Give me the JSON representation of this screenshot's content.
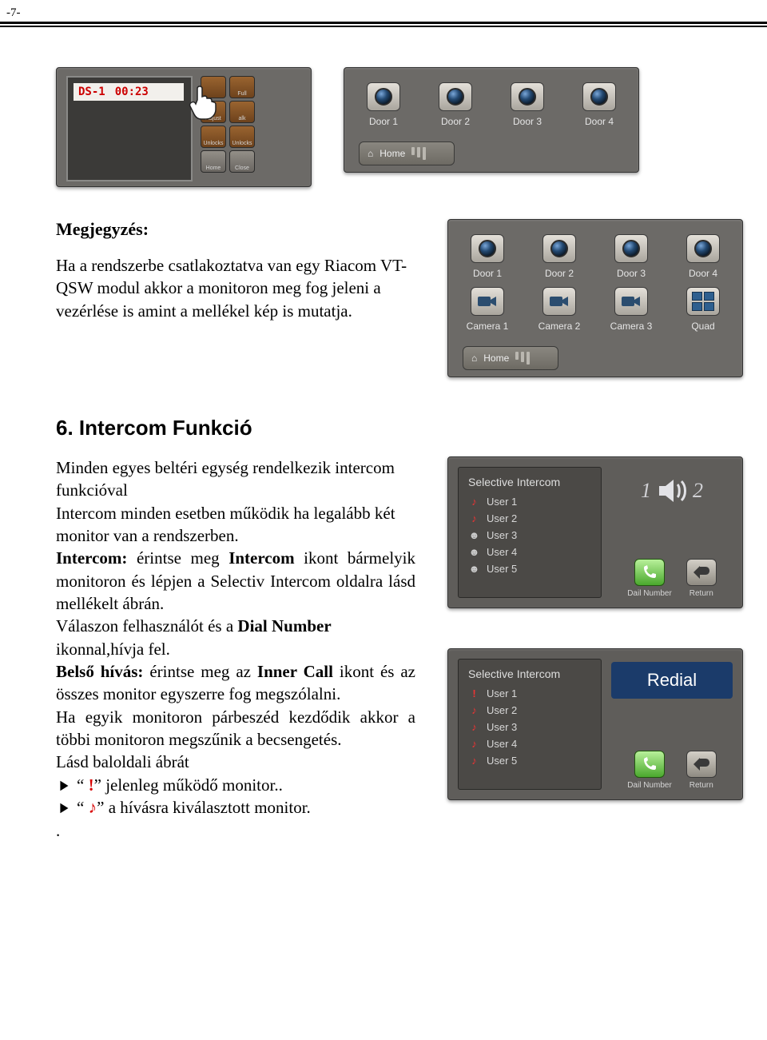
{
  "page_number": "-7-",
  "shot1": {
    "title": "DS-1",
    "time": "00:23",
    "buttons": [
      "",
      "Full",
      "Adjust",
      "alk",
      "Unlocks",
      "Unlocks",
      "Home",
      "Close"
    ]
  },
  "shot2": {
    "doors": [
      "Door 1",
      "Door 2",
      "Door 3",
      "Door 4"
    ],
    "home": "Home"
  },
  "note_label": "Megjegyzés:",
  "note_para": "Ha a rendszerbe csatlakoztatva van egy Riacom VT-QSW modul akkor a monitoron meg fog jeleni a vezérlése is amint a mellékel kép is mutatja.",
  "shot3": {
    "doors": [
      "Door 1",
      "Door 2",
      "Door 3",
      "Door 4"
    ],
    "cams": [
      "Camera 1",
      "Camera 2",
      "Camera 3",
      "Quad"
    ],
    "home": "Home"
  },
  "section_title": "6. Intercom Funkció",
  "intercom_text": {
    "l1": "Minden egyes beltéri egység rendelkezik  intercom funkcióval",
    "l2a": "Intercom minden esetben működik ha legalább két monitor van a rendszerben.",
    "l3_prefix": "Intercom:",
    "l3": " érintse meg ",
    "l3b": "Intercom",
    "l3c": " ikont bármelyik monitoron és lépjen a  Selectiv Intercom oldalra lásd mellékelt ábrán.",
    "l4a": "Válaszon felhasználót és a ",
    "l4b": "Dial Number",
    "l4c": " ikonnal,hívja fel.",
    "l5a": "Belső hívás:",
    "l5b": " érintse meg az ",
    "l5c": "Inner Call",
    "l5d": " ikont és az összes monitor egyszerre fog megszólalni.",
    "l6": "Ha egyik monitoron párbeszéd kezdődik akkor a többi monitoron megszűnik a becsengetés.",
    "l7": "Lásd baloldali ábrát",
    "bullet1a": "“ ",
    "bullet1_exc": "!",
    "bullet1b": "” jelenleg működő monitor..",
    "bullet2a": "“ ",
    "bullet2_note": "♪",
    "bullet2b": "” a hívásra kiválasztott monitor.",
    "dot": "."
  },
  "ipanel1": {
    "title": "Selective Intercom",
    "users": [
      "User 1",
      "User 2",
      "User 3",
      "User 4",
      "User 5"
    ],
    "one": "1",
    "two": "2",
    "dail": "Dail Number",
    "ret": "Return"
  },
  "ipanel2": {
    "title": "Selective Intercom",
    "users": [
      "User 1",
      "User 2",
      "User 3",
      "User 4",
      "User 5"
    ],
    "redial": "Redial",
    "dail": "Dail Number",
    "ret": "Return"
  }
}
